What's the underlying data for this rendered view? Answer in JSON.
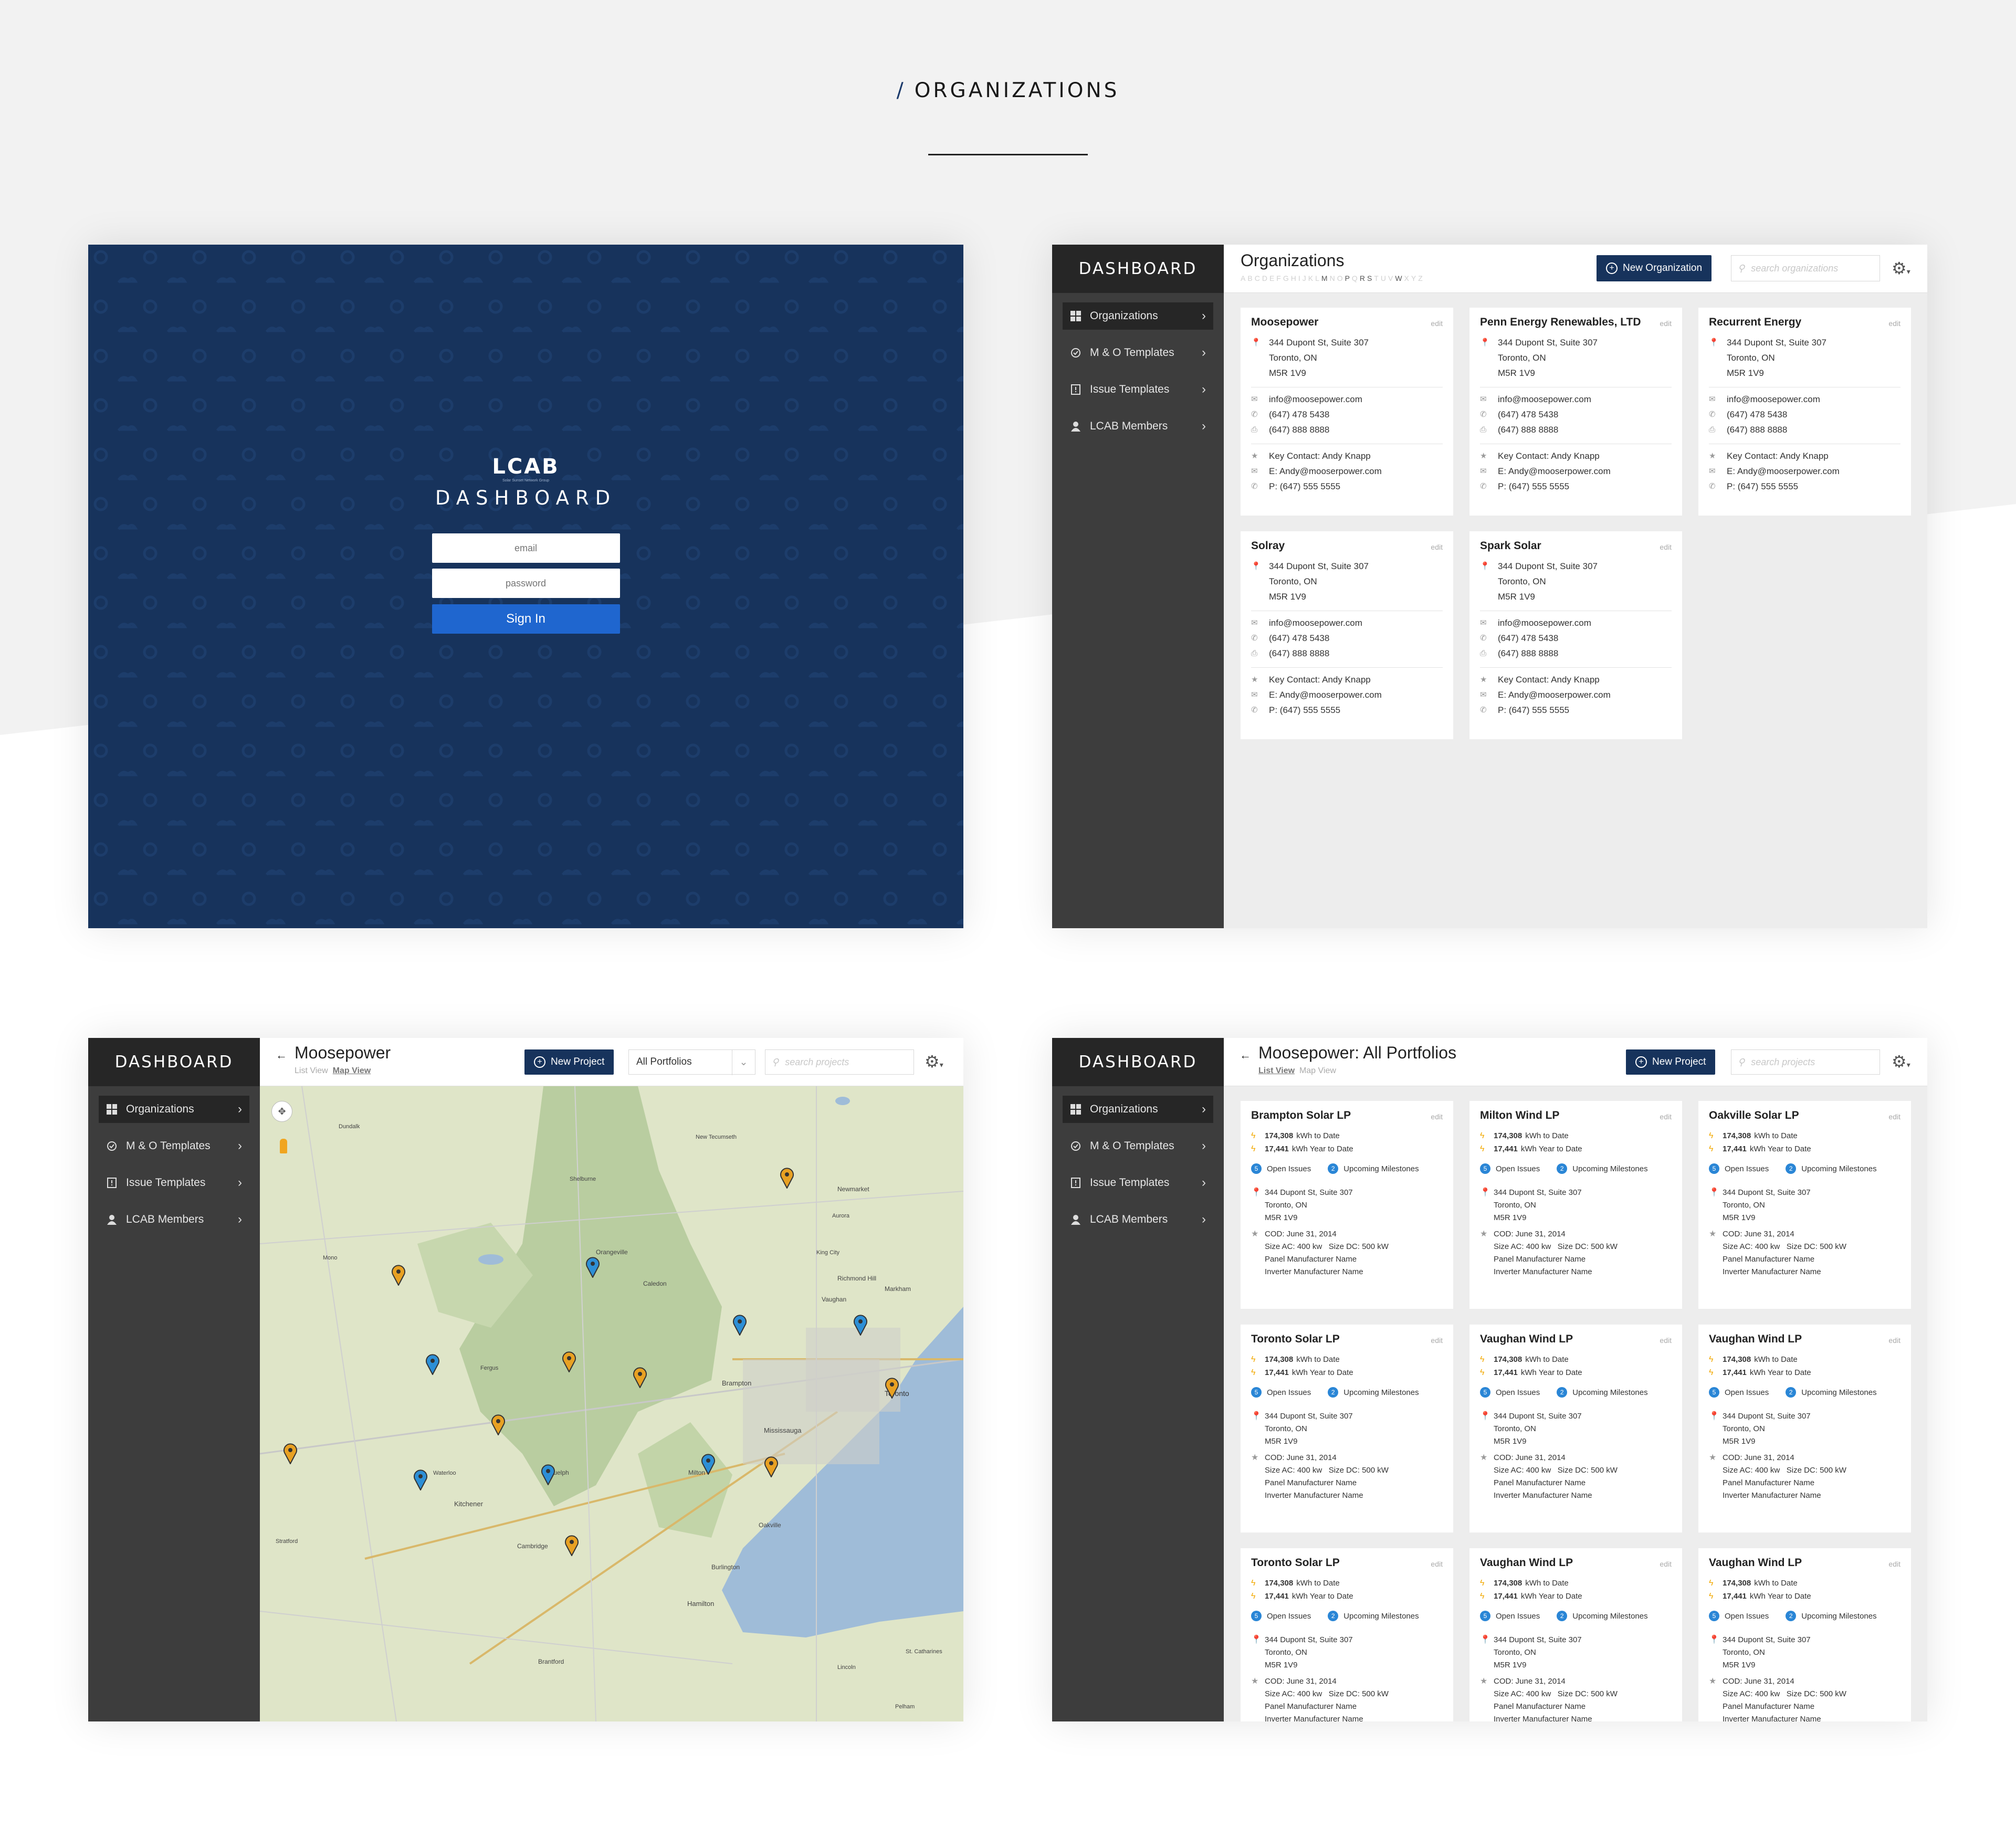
{
  "section_heading": {
    "slash": "/",
    "title": "ORGANIZATIONS"
  },
  "login": {
    "logo": "LCAB",
    "logo_tagline": "Solar Sunset Network Group",
    "title": "DASHBOARD",
    "email_placeholder": "email",
    "password_placeholder": "password",
    "signin_label": "Sign In"
  },
  "sidebar": {
    "title": "DASHBOARD",
    "items": [
      {
        "label": "Organizations",
        "icon": "grid-icon"
      },
      {
        "label": "M & O Templates",
        "icon": "check-circle-icon"
      },
      {
        "label": "Issue Templates",
        "icon": "document-icon"
      },
      {
        "label": "LCAB Members",
        "icon": "user-icon"
      }
    ]
  },
  "organizations_screen": {
    "title": "Organizations",
    "alphabet": [
      "A",
      "B",
      "C",
      "D",
      "E",
      "F",
      "G",
      "H",
      "I",
      "J",
      "K",
      "L",
      "M",
      "N",
      "O",
      "P",
      "Q",
      "R",
      "S",
      "T",
      "U",
      "V",
      "W",
      "X",
      "Y",
      "Z"
    ],
    "active_letters": [
      "M",
      "P",
      "R",
      "S",
      "W"
    ],
    "new_button": "New Organization",
    "search_placeholder": "search organizations",
    "edit_label": "edit",
    "cards": [
      {
        "name": "Moosepower",
        "addr1": "344 Dupont St, Suite 307",
        "addr2": "Toronto, ON",
        "addr3": "M5R 1V9",
        "email": "info@moosepower.com",
        "phone": "(647) 478 5438",
        "fax": "(647) 888 8888",
        "contact": "Key Contact: Andy Knapp",
        "contact_email": "E: Andy@mooserpower.com",
        "contact_phone": "P: (647) 555 5555"
      },
      {
        "name": "Penn Energy Renewables, LTD",
        "addr1": "344 Dupont St, Suite 307",
        "addr2": "Toronto, ON",
        "addr3": "M5R 1V9",
        "email": "info@moosepower.com",
        "phone": "(647) 478 5438",
        "fax": "(647) 888 8888",
        "contact": "Key Contact: Andy Knapp",
        "contact_email": "E: Andy@mooserpower.com",
        "contact_phone": "P: (647) 555 5555"
      },
      {
        "name": "Recurrent Energy",
        "addr1": "344 Dupont St, Suite 307",
        "addr2": "Toronto, ON",
        "addr3": "M5R 1V9",
        "email": "info@moosepower.com",
        "phone": "(647) 478 5438",
        "fax": "(647) 888 8888",
        "contact": "Key Contact: Andy Knapp",
        "contact_email": "E: Andy@mooserpower.com",
        "contact_phone": "P: (647) 555 5555"
      },
      {
        "name": "Solray",
        "addr1": "344 Dupont St, Suite 307",
        "addr2": "Toronto, ON",
        "addr3": "M5R 1V9",
        "email": "info@moosepower.com",
        "phone": "(647) 478 5438",
        "fax": "(647) 888 8888",
        "contact": "Key Contact: Andy Knapp",
        "contact_email": "E: Andy@mooserpower.com",
        "contact_phone": "P: (647) 555 5555"
      },
      {
        "name": "Spark Solar",
        "addr1": "344 Dupont St, Suite 307",
        "addr2": "Toronto, ON",
        "addr3": "M5R 1V9",
        "email": "info@moosepower.com",
        "phone": "(647) 478 5438",
        "fax": "(647) 888 8888",
        "contact": "Key Contact: Andy Knapp",
        "contact_email": "E: Andy@mooserpower.com",
        "contact_phone": "P: (647) 555 5555"
      }
    ]
  },
  "map_screen": {
    "title": "Moosepower",
    "list_view": "List View",
    "map_view": "Map View",
    "new_button": "New Project",
    "portfolio_select": "All Portfolios",
    "search_placeholder": "search projects",
    "pin_colors": {
      "orange": "#e8a123",
      "blue": "#2d8fd6"
    },
    "pins": [
      {
        "color": "orange"
      },
      {
        "color": "blue"
      },
      {
        "color": "orange"
      },
      {
        "color": "blue"
      },
      {
        "color": "blue"
      },
      {
        "color": "orange"
      },
      {
        "color": "orange"
      },
      {
        "color": "orange"
      },
      {
        "color": "blue"
      },
      {
        "color": "orange"
      },
      {
        "color": "blue"
      },
      {
        "color": "blue"
      },
      {
        "color": "orange"
      },
      {
        "color": "blue"
      },
      {
        "color": "orange"
      },
      {
        "color": "orange"
      }
    ],
    "place_labels": [
      "Toronto",
      "Brampton",
      "Mississauga",
      "Vaughan",
      "Markham",
      "Hamilton",
      "Kitchener",
      "Guelph",
      "Cambridge",
      "Milton",
      "Oakville",
      "Burlington",
      "Orangeville",
      "Caledon",
      "Newmarket",
      "Richmond Hill",
      "Brantford",
      "Stratford",
      "Fergus",
      "Waterloo",
      "St. Catharines",
      "Lincoln",
      "Pelham",
      "New Tecumseth",
      "Dundalk",
      "Shelburne",
      "Mono",
      "Aurora",
      "King City"
    ]
  },
  "portfolio_screen": {
    "title": "Moosepower: All Portfolios",
    "list_view": "List View",
    "map_view": "Map View",
    "new_button": "New Project",
    "search_placeholder": "search projects",
    "edit_label": "edit",
    "kwh_to_date": "174,308",
    "kwh_to_date_label": "kWh to Date",
    "kwh_year": "17,441",
    "kwh_year_label": "kWh Year to Date",
    "open_issues_count": "5",
    "open_issues_label": "Open Issues",
    "milestones_count": "2",
    "milestones_label": "Upcoming Milestones",
    "addr1": "344 Dupont St, Suite 307",
    "addr2": "Toronto, ON",
    "addr3": "M5R 1V9",
    "cod": "COD: June 31, 2014",
    "size_ac": "Size AC: 400 kw",
    "size_dc": "Size DC: 500 kW",
    "panel": "Panel Manufacturer Name",
    "inverter": "Inverter Manufacturer Name",
    "cards": [
      {
        "name": "Brampton Solar LP"
      },
      {
        "name": "Milton Wind LP"
      },
      {
        "name": "Oakville Solar LP"
      },
      {
        "name": "Toronto Solar LP"
      },
      {
        "name": "Vaughan Wind LP"
      },
      {
        "name": "Vaughan Wind LP"
      },
      {
        "name": "Toronto Solar LP"
      },
      {
        "name": "Vaughan Wind LP"
      },
      {
        "name": "Vaughan Wind LP"
      }
    ]
  }
}
